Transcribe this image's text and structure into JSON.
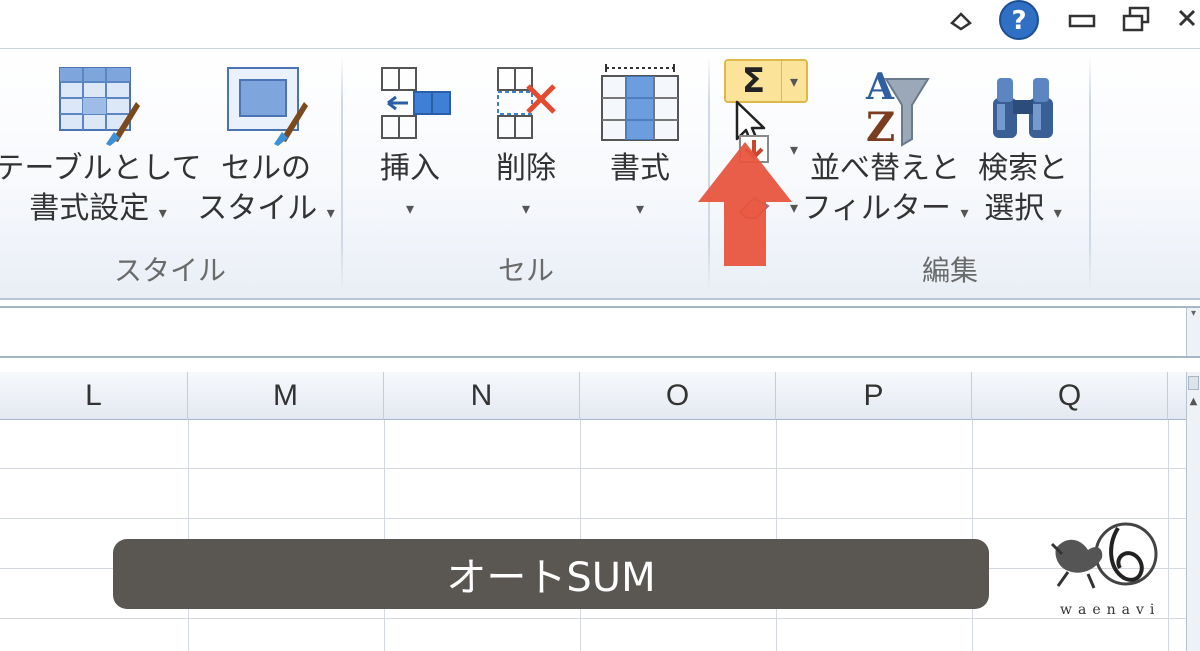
{
  "window": {
    "controls": {
      "minimize_ribbon": "minimize-ribbon-icon",
      "help": "help-icon",
      "minimize": "minimize-icon",
      "restore": "restore-icon",
      "close": "close-icon"
    }
  },
  "ribbon": {
    "groups": [
      {
        "label": "スタイル",
        "buttons": [
          {
            "line1": "テーブルとして",
            "line2": "書式設定",
            "caret": "▾",
            "icon": "format-as-table-icon"
          },
          {
            "line1": "セルの",
            "line2": "スタイル",
            "caret": "▾",
            "icon": "cell-styles-icon"
          }
        ]
      },
      {
        "label": "セル",
        "buttons": [
          {
            "line1": "挿入",
            "caret": "▾",
            "icon": "insert-cells-icon"
          },
          {
            "line1": "削除",
            "caret": "▾",
            "icon": "delete-cells-icon"
          },
          {
            "line1": "書式",
            "caret": "▾",
            "icon": "format-cells-icon"
          }
        ]
      },
      {
        "label": "編集",
        "autosum": {
          "symbol": "Σ",
          "caret": "▾",
          "icon": "autosum-icon"
        },
        "fill": {
          "caret": "▾",
          "icon": "fill-down-icon"
        },
        "clear": {
          "caret": "▾",
          "icon": "eraser-icon"
        },
        "buttons": [
          {
            "line1": "並べ替えと",
            "line2": "フィルター",
            "caret": "▾",
            "icon": "sort-filter-icon"
          },
          {
            "line1": "検索と",
            "line2": "選択",
            "caret": "▾",
            "icon": "find-select-icon"
          }
        ]
      }
    ]
  },
  "sheet": {
    "columns": [
      "L",
      "M",
      "N",
      "O",
      "P",
      "Q"
    ]
  },
  "overlay": {
    "caption": "オートSUM",
    "arrow_color": "#e8553e",
    "logo_text": "waenavi"
  },
  "colors": {
    "autosum_highlight": "#fbe49a",
    "caption_bg": "#5a5752"
  }
}
